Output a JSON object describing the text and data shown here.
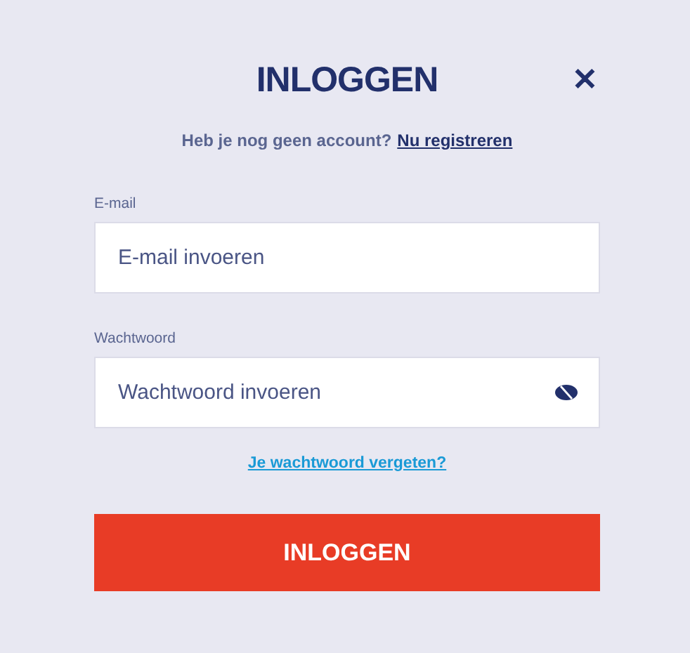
{
  "title": "INLOGGEN",
  "close": {
    "label": "✕"
  },
  "register_prompt": {
    "text": "Heb je nog geen account?",
    "link": "Nu registreren"
  },
  "fields": [
    {
      "kind": "text",
      "label": "E-mail",
      "placeholder": "E-mail invoeren"
    },
    {
      "kind": "password",
      "label": "Wachtwoord",
      "placeholder": "Wachtwoord invoeren"
    }
  ],
  "forgot_link": "Je wachtwoord vergeten?",
  "submit": "INLOGGEN"
}
